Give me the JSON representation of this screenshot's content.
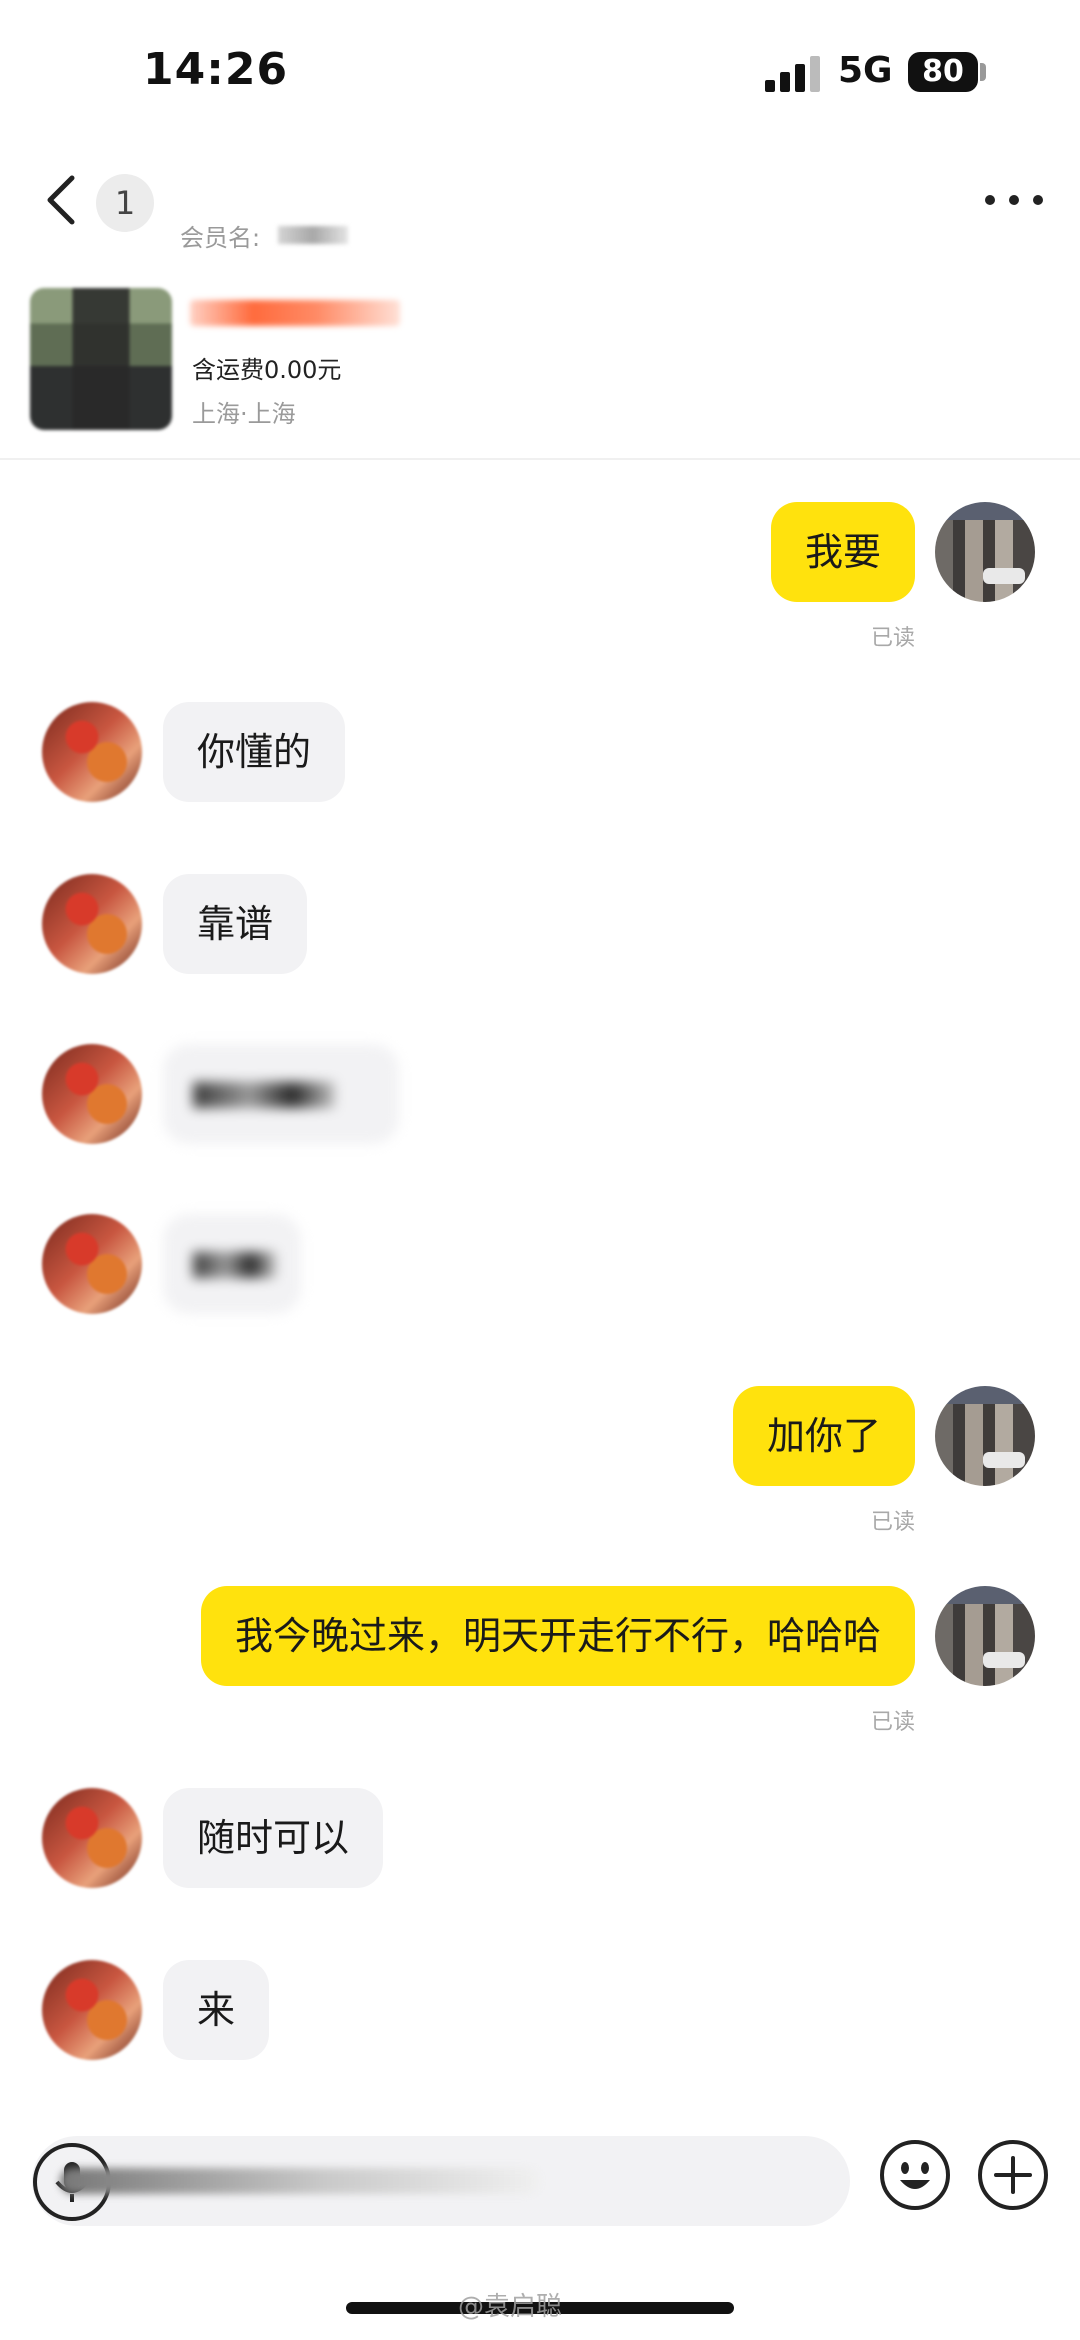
{
  "status_bar": {
    "time": "14:26",
    "network": "5G",
    "battery": "80"
  },
  "header": {
    "unread_count": "1",
    "title": "",
    "member_label": "会员名:",
    "more_icon": "more-dots-icon",
    "back_icon": "chevron-left-icon"
  },
  "product": {
    "name": "",
    "shipping": "含运费0.00元",
    "location": "上海·上海"
  },
  "messages": [
    {
      "from": "me",
      "text": "我要",
      "status": "已读"
    },
    {
      "from": "seller",
      "text": "你懂的"
    },
    {
      "from": "seller",
      "text": "靠谱"
    },
    {
      "from": "seller",
      "text": "",
      "blurred": true
    },
    {
      "from": "seller",
      "text": "",
      "blurred": true
    },
    {
      "from": "me",
      "text": "加你了",
      "status": "已读"
    },
    {
      "from": "me",
      "text": "我今晚过来，明天开走行不行，哈哈哈",
      "status": "已读"
    },
    {
      "from": "seller",
      "text": "随时可以"
    },
    {
      "from": "seller",
      "text": "来"
    }
  ],
  "input": {
    "placeholder": "",
    "voice_icon": "microphone-icon",
    "emoji_icon": "emoji-icon",
    "plus_icon": "plus-circle-icon"
  },
  "watermark": "@袁启聪",
  "colors": {
    "my_bubble": "#ffe20d",
    "other_bubble": "#f2f2f4",
    "read_receipt": "#a8a8a8"
  }
}
